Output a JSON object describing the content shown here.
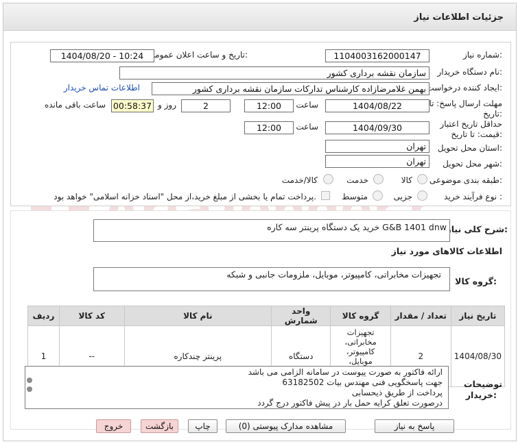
{
  "window_title": "جزئیات اطلاعات نیاز",
  "fields": {
    "need_number_label": "شماره نیاز:",
    "need_number": "1104003162000147",
    "announce_label": "تاریخ و ساعت اعلان عمومی:",
    "announce_value": "1404/08/20 - 10:24",
    "buyer_org_label": "نام دستگاه خریدار:",
    "buyer_org": "سازمان نقشه برداری کشور",
    "requester_label": "ایجاد کننده درخواست:",
    "requester": "بهمن غلامرضازاده کارشناس تدارکات  سازمان نقشه برداری کشور",
    "contact_link": "اطلاعات تماس خریدار",
    "reply_deadline_label_1": "مهلت ارسال پاسخ: تا",
    "reply_deadline_label_2": "تاریخ:",
    "reply_date": "1404/08/22",
    "time_label": "ساعت",
    "reply_time": "12:00",
    "days_value": "2",
    "days_label": "روز و",
    "remaining_value": "00:58:37",
    "remaining_label": "ساعت باقی مانده",
    "validity_label_1": "حداقل تاریخ اعتبار",
    "validity_label_2": "قیمت: تا تاریخ:",
    "validity_date": "1404/09/30",
    "validity_time": "12:00",
    "province_label": "استان محل تحویل:",
    "province": "تهران",
    "city_label": "شهر محل تحویل:",
    "city": "تهران",
    "category_label": "طبقه بندی موضوعی:",
    "cat_goods": "کالا",
    "cat_service": "خدمت",
    "cat_goods_service": "کالا/خدمت",
    "process_label": "نوع فرآیند خرید :",
    "proc_partial": "جزیی",
    "proc_medium": "متوسط",
    "payment_note": "پرداخت تمام یا بخشی از مبلغ خرید،از محل \"اسناد خزانه اسلامی\" خواهد بود."
  },
  "description": {
    "label": "شرح کلی نیاز:",
    "value": "خرید یک دستگاه پرینتر سه کاره G&B 1401 dnw"
  },
  "goods_info": {
    "heading": "اطلاعات کالاهای مورد نیاز",
    "group_label": "گروه کالا:",
    "group_value": "تجهیزات مخابراتی، کامپیوتر، موبایل، ملزومات جانبی و شبکه"
  },
  "table": {
    "headers": [
      "ردیف",
      "کد کالا",
      "نام کالا",
      "واحد شمارش",
      "گروه کالا",
      "تعداد / مقدار",
      "تاریخ نیاز"
    ],
    "rows": [
      {
        "row": "1",
        "code": "--",
        "name": "پرینتر چندکاره",
        "unit": "دستگاه",
        "group": "تجهیزات مخابراتی، کامپیوتر، موبایل، ملزومات جانبی و شبکه",
        "qty": "2",
        "date": "1404/08/30"
      }
    ]
  },
  "notes": {
    "label_1": "توضیحات",
    "label_2": "خریدار:",
    "lines": [
      "ارائه فاکتور به صورت پیوست در سامانه  الزامی می باشد",
      " جهت پاسخگویی فنی مهندس بیات 63182502",
      "پرداخت از طریق ذیحسابی",
      "درصورت تعلق کرایه حمل بار در پیش فاکتور درج گردد"
    ]
  },
  "buttons": {
    "reply": "پاسخ به نیاز",
    "view_docs": "مشاهده مدارک پیوستی (0)",
    "print": "چاپ",
    "back": "بازگشت",
    "exit": "خروج"
  },
  "watermark_text": "AriaTender.net"
}
